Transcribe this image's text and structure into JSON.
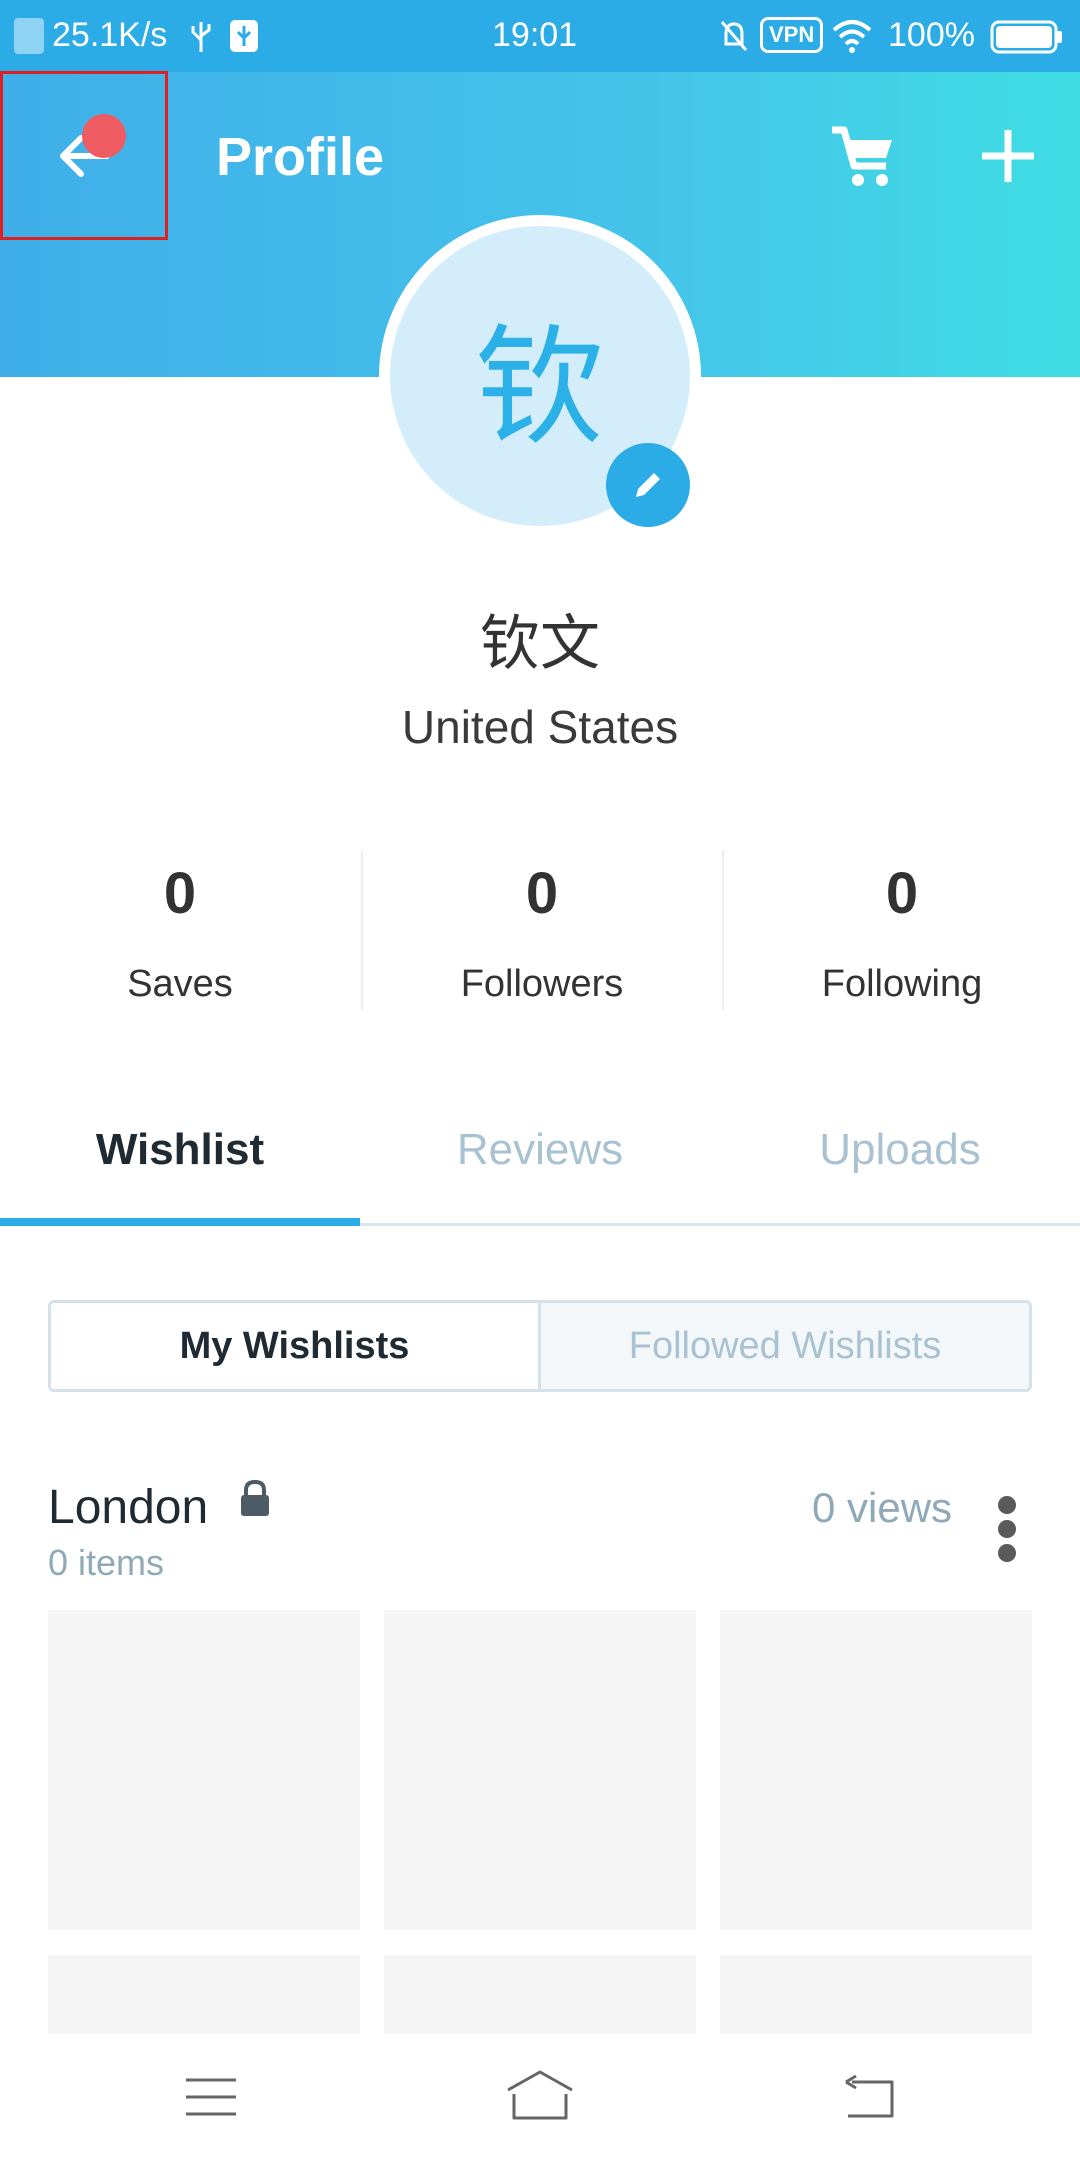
{
  "status_bar": {
    "speed": "25.1K/s",
    "time": "19:01",
    "vpn": "VPN",
    "battery": "100%"
  },
  "header": {
    "title": "Profile"
  },
  "profile": {
    "avatar_char": "钦",
    "name": "钦文",
    "country": "United States"
  },
  "stats": [
    {
      "value": "0",
      "label": "Saves"
    },
    {
      "value": "0",
      "label": "Followers"
    },
    {
      "value": "0",
      "label": "Following"
    }
  ],
  "tabs": [
    {
      "label": "Wishlist",
      "active": true
    },
    {
      "label": "Reviews",
      "active": false
    },
    {
      "label": "Uploads",
      "active": false
    }
  ],
  "segments": {
    "left": "My Wishlists",
    "right": "Followed Wishlists"
  },
  "wishlist": {
    "name": "London",
    "items": "0 items",
    "views": "0 views"
  },
  "colors": {
    "accent": "#2bace6",
    "notification": "#ee5c61"
  }
}
